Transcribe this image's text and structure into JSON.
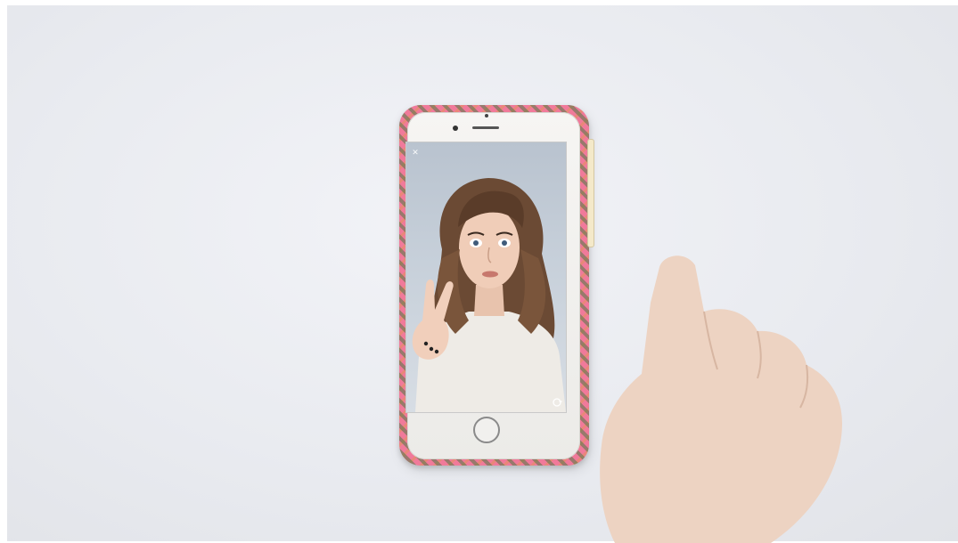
{
  "scene": {
    "background_color": "#e9ebf0",
    "phone_case_color": "#f07a9a",
    "phone_body_color": "#f3f2ef"
  },
  "screen": {
    "close_icon": "close-icon",
    "flip_icon": "flip-camera-icon",
    "subject": "selfie-camera-preview"
  }
}
